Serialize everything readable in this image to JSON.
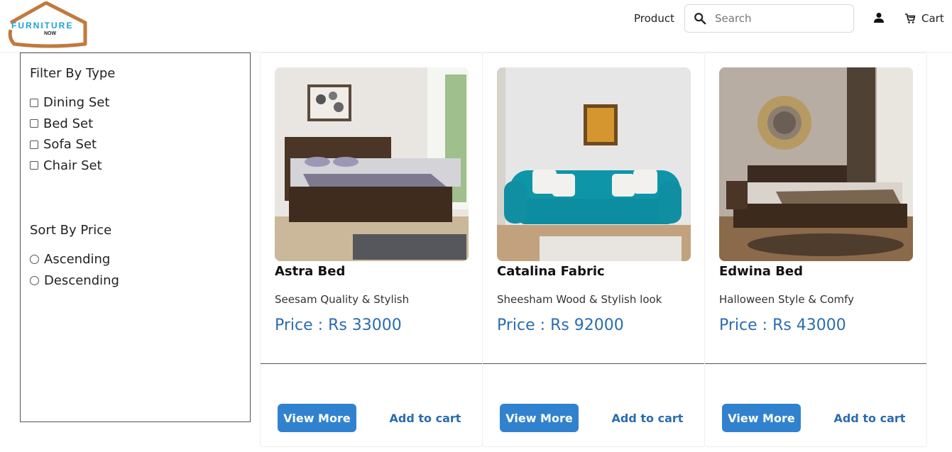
{
  "brand": {
    "logo_text_main": "FURNITURE",
    "logo_text_sub": "NOW"
  },
  "header": {
    "nav_product": "Product",
    "search_placeholder": "Search",
    "cart_label": "Cart"
  },
  "filter": {
    "title": "Filter By Type",
    "types": [
      {
        "label": "Dining Set",
        "checked": false
      },
      {
        "label": "Bed Set",
        "checked": false
      },
      {
        "label": "Sofa Set",
        "checked": false
      },
      {
        "label": "Chair Set",
        "checked": false
      }
    ]
  },
  "sort": {
    "title": "Sort By Price",
    "options": [
      {
        "label": "Ascending",
        "selected": false
      },
      {
        "label": "Descending",
        "selected": false
      }
    ]
  },
  "products": [
    {
      "name": "Astra Bed",
      "description": "Seesam Quality & Stylish",
      "price": "Price : Rs 33000",
      "view_label": "View More",
      "add_label": "Add to cart"
    },
    {
      "name": "Catalina Fabric",
      "description": "Sheesham Wood & Stylish look",
      "price": "Price : Rs 92000",
      "view_label": "View More",
      "add_label": "Add to cart"
    },
    {
      "name": "Edwina Bed",
      "description": "Halloween Style & Comfy",
      "price": "Price : Rs 43000",
      "view_label": "View More",
      "add_label": "Add to cart"
    }
  ],
  "colors": {
    "accent": "#3182ce",
    "price": "#2b6cb0",
    "logo_roof": "#c07a3e",
    "logo_text": "#1aa3d9"
  }
}
